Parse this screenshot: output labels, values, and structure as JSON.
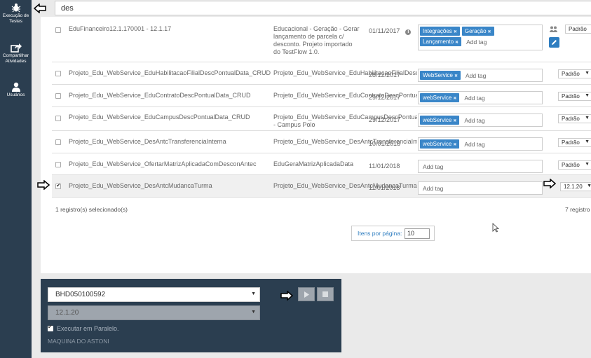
{
  "sidebar": {
    "items": [
      {
        "label_1": "Execução de",
        "label_2": "Testes",
        "icon": "bug-icon"
      },
      {
        "label_1": "Compartilhar",
        "label_2": "Atividades",
        "icon": "share-icon"
      },
      {
        "label_1": "Usuários",
        "label_2": "",
        "icon": "user-icon"
      }
    ]
  },
  "search": {
    "value": "des"
  },
  "rows": [
    {
      "name": "EduFinanceiro12.1.170001 - 12.1.17",
      "desc": "Educacional - Geração - Gerar lançamento de parcela c/ desconto. Projeto importado do TestFlow 1.0.",
      "date": "01/11/2017",
      "tags": [
        "Integrações",
        "Geração",
        "Lançamento"
      ],
      "add_tag": "Add tag",
      "select": "Padrão",
      "checked": false
    },
    {
      "name": "Projeto_Edu_WebService_EduHabilitacaoFilialDescPontualData_CRUD",
      "desc": "Projeto_Edu_WebService_EduHabilitacaoFilialDescF",
      "date": "28/12/2017",
      "tags": [
        "WebService"
      ],
      "add_tag": "Add tag",
      "select": "Padrão",
      "checked": false
    },
    {
      "name": "Projeto_Edu_WebService_EduContratoDescPontualData_CRUD",
      "desc": "Projeto_Edu_WebService_EduContratoDescPontualD",
      "date": "29/12/2017",
      "tags": [
        "webService"
      ],
      "add_tag": "Add tag",
      "select": "Padrão",
      "checked": false
    },
    {
      "name": "Projeto_Edu_WebService_EduCampusDescPontualData_CRUD",
      "desc": "Projeto_Edu_WebService_EduCampusDescPontualD",
      "desc2": "- Campus Polo",
      "date": "29/12/2017",
      "tags": [
        "webService"
      ],
      "add_tag": "Add tag",
      "select": "Padrão",
      "checked": false
    },
    {
      "name": "Projeto_Edu_WebService_DesAntcTransferenciaInterna",
      "desc": "Projeto_Edu_WebService_DesAntcTransferenciaInte",
      "date": "10/01/2018",
      "tags": [
        "webService"
      ],
      "add_tag": "Add tag",
      "select": "Padrão",
      "checked": false
    },
    {
      "name": "Projeto_Edu_WebService_OfertarMatrizAplicadaComDesconAntec",
      "desc": "EduGeraMatrizAplicadaData",
      "date": "11/01/2018",
      "tags": [],
      "add_tag": "Add tag",
      "select": "Padrão",
      "checked": false
    },
    {
      "name": "Projeto_Edu_WebService_DesAntcMudancaTurma",
      "desc": "Projeto_Edu_WebService_DesAntcMudancaTurma",
      "date": "11/01/2018",
      "tags": [],
      "add_tag": "Add tag",
      "select": "12.1.20",
      "checked": true
    }
  ],
  "footer": {
    "selected": "1 registro(s) selecionado(s)",
    "count": "7 registro"
  },
  "pagination": {
    "label": "Itens por página:",
    "value": "10"
  },
  "run": {
    "machine_select": "BHD050100592",
    "version_select": "12.1.20",
    "parallel_label": "Executar em Paralelo.",
    "parallel_checked": true,
    "machine_name": "MAQUINA DO ASTONI"
  },
  "colors": {
    "sidebar": "#2b3e50",
    "tag": "#3a86c8",
    "panel_bg": "#eaeaea"
  }
}
